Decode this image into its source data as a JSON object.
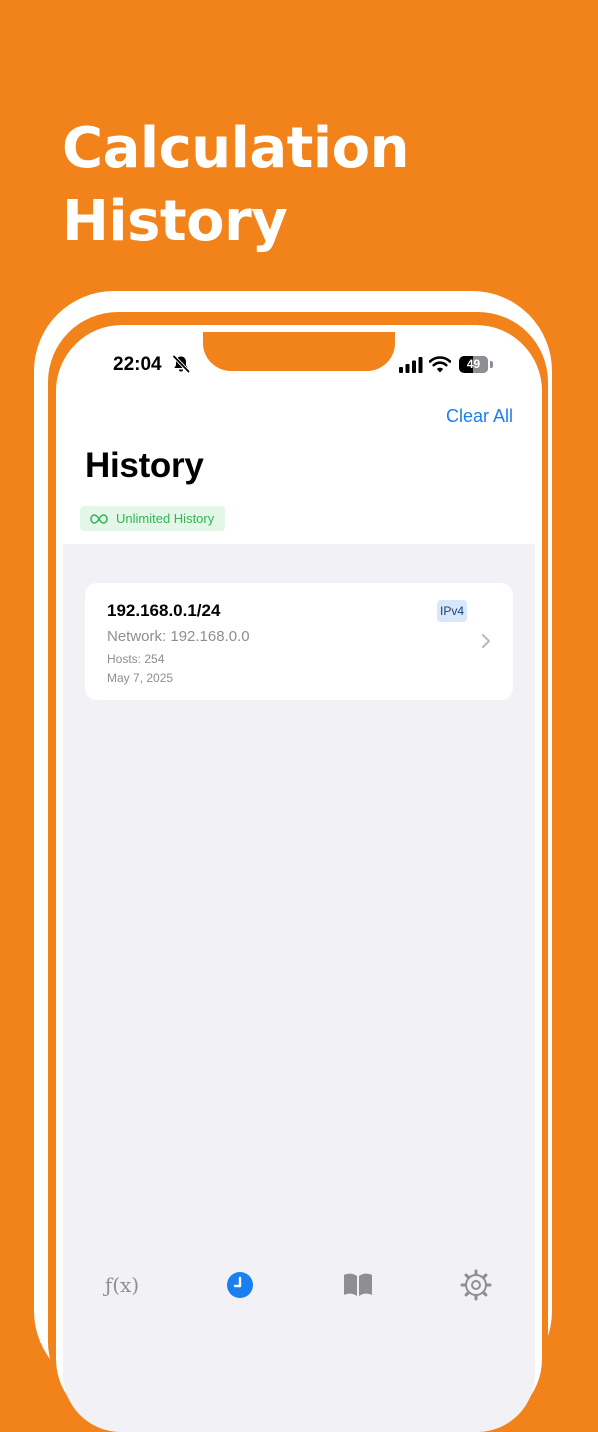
{
  "promo": {
    "headline_line1": "Calculation",
    "headline_line2": "History"
  },
  "status_bar": {
    "time": "22:04",
    "battery": "49",
    "battery_percent": 49
  },
  "nav": {
    "clear_all_label": "Clear All"
  },
  "page": {
    "title": "History",
    "badge_label": "Unlimited History"
  },
  "history": [
    {
      "address": "192.168.0.1/24",
      "network": "Network: 192.168.0.0",
      "hosts": "Hosts: 254",
      "date": "May 7, 2025",
      "type": "IPv4"
    }
  ],
  "tabs": [
    {
      "icon": "function-icon",
      "label": "ƒ(x)",
      "selected": false
    },
    {
      "icon": "clock-icon",
      "selected": true
    },
    {
      "icon": "book-icon",
      "selected": false
    },
    {
      "icon": "gear-icon",
      "selected": false
    }
  ],
  "colors": {
    "background": "#f2821a",
    "accent": "#1a7ff0",
    "badge_green": "#34b457",
    "badge_green_bg": "#e4f6e8",
    "ipv4_badge_bg": "#d8e8fa",
    "secondary_text": "#8e8e93"
  }
}
